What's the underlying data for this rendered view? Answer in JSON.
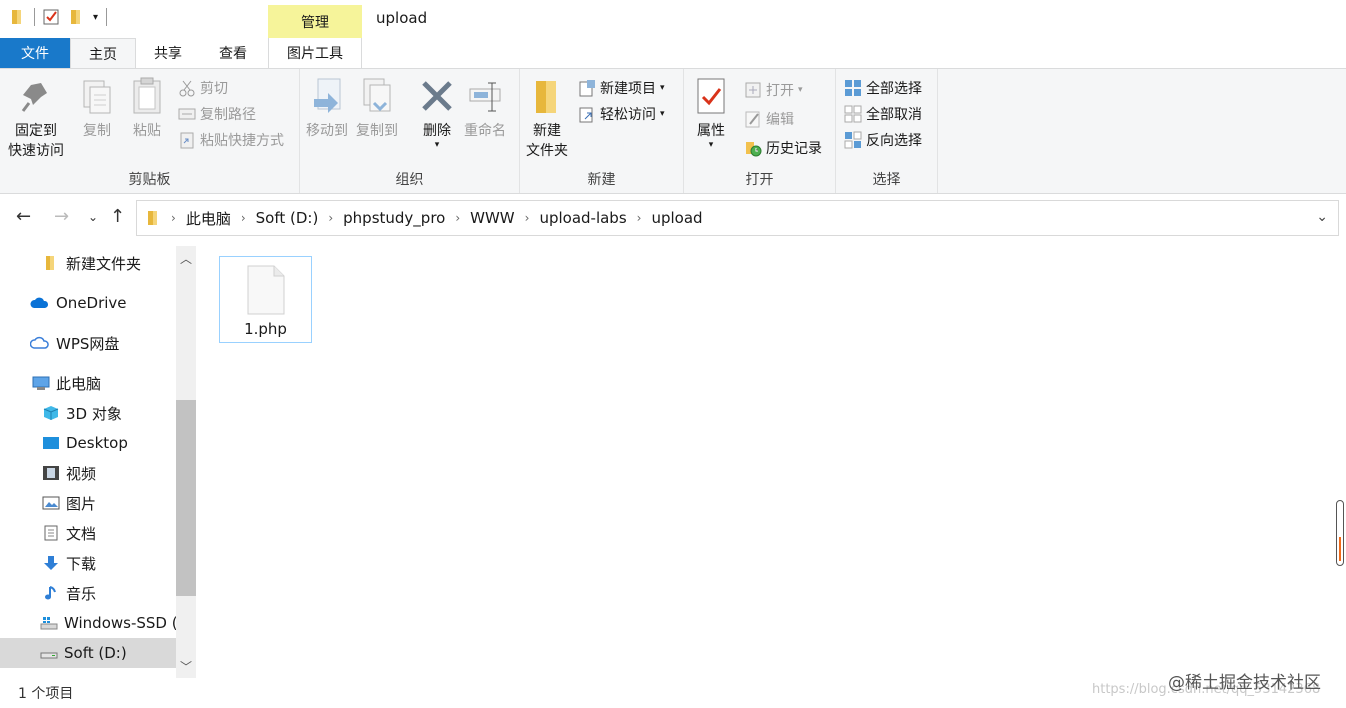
{
  "window": {
    "title": "upload",
    "context_tab": "管理"
  },
  "ribbon_tabs": {
    "file": "文件",
    "home": "主页",
    "share": "共享",
    "view": "查看",
    "picture_tools": "图片工具"
  },
  "clipboard": {
    "group": "剪贴板",
    "pin_line1": "固定到",
    "pin_line2": "快速访问",
    "copy": "复制",
    "paste": "粘贴",
    "cut": "剪切",
    "copy_path": "复制路径",
    "paste_shortcut": "粘贴快捷方式"
  },
  "organize": {
    "group": "组织",
    "move_to": "移动到",
    "copy_to": "复制到",
    "delete": "删除",
    "rename": "重命名"
  },
  "new": {
    "group": "新建",
    "new_folder_line1": "新建",
    "new_folder_line2": "文件夹",
    "new_item": "新建项目",
    "easy_access": "轻松访问"
  },
  "open": {
    "group": "打开",
    "properties": "属性",
    "open": "打开",
    "edit": "编辑",
    "history": "历史记录"
  },
  "select": {
    "group": "选择",
    "select_all": "全部选择",
    "select_none": "全部取消",
    "invert": "反向选择"
  },
  "breadcrumbs": [
    "此电脑",
    "Soft (D:)",
    "phpstudy_pro",
    "WWW",
    "upload-labs",
    "upload"
  ],
  "nav_pane": {
    "items": [
      "新建文件夹",
      "OneDrive",
      "WPS网盘",
      "此电脑",
      "3D 对象",
      "Desktop",
      "视频",
      "图片",
      "文档",
      "下载",
      "音乐",
      "Windows-SSD (",
      "Soft (D:)"
    ]
  },
  "files": [
    {
      "name": "1.php"
    }
  ],
  "status": {
    "item_count": "1 个项目"
  },
  "watermark": {
    "text": "@稀土掘金技术社区",
    "url_text": "https://blog.csdn.net/qq_53142368"
  },
  "colors": {
    "file_tab": "#1979ca",
    "manage_tab": "#f6f49a",
    "selection_border": "#99d1ff",
    "folder": "#f2c14e"
  }
}
